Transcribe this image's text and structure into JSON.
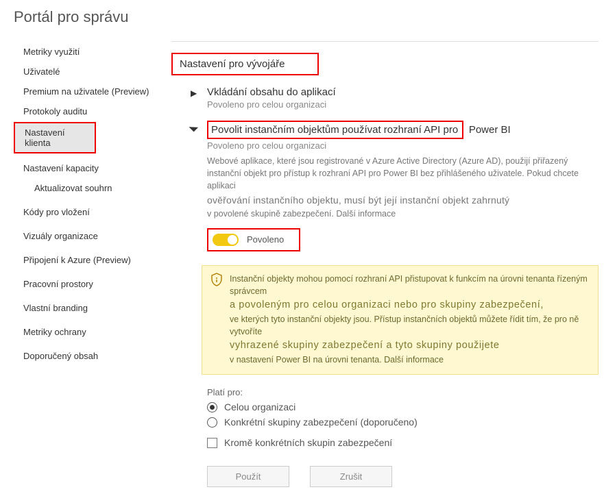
{
  "page_title": "Portál pro správu",
  "sidebar": {
    "items": [
      {
        "label": "Metriky využití"
      },
      {
        "label": "Uživatelé"
      },
      {
        "label": "Premium na uživatele (Preview)"
      },
      {
        "label": "Protokoly auditu"
      },
      {
        "label": "Nastavení klienta",
        "selected": true,
        "highlight": true
      },
      {
        "label": "Nastavení kapacity"
      },
      {
        "label": "Aktualizovat souhrn",
        "sub": true
      },
      {
        "label": "Kódy pro vložení"
      },
      {
        "label": "Vizuály organizace"
      },
      {
        "label": "Připojení k Azure (Preview)"
      },
      {
        "label": "Pracovní prostory"
      },
      {
        "label": "Vlastní branding"
      },
      {
        "label": "Metriky ochrany"
      },
      {
        "label": "Doporučený obsah"
      }
    ]
  },
  "section_heading": "Nastavení pro vývojáře",
  "setting_embed": {
    "title": "Vkládání obsahu do aplikací",
    "status": "Povoleno pro celou organizaci"
  },
  "setting_sp": {
    "title": "Povolit instančním objektům používat rozhraní API pro",
    "title_suffix": "Power BI",
    "status": "Povoleno pro celou organizaci",
    "desc1": "Webové aplikace, které jsou registrované v Azure Active Directory (Azure AD), použijí přiřazený instanční objekt pro přístup k rozhraní API pro Power BI bez přihlášeného uživatele. Pokud chcete aplikaci ",
    "desc_em": "ověřování instančního objektu, musí být její instanční objekt zahrnutý",
    "desc2": "v povolené skupině zabezpečení. Další informace",
    "toggle_label": "Povoleno"
  },
  "warning": {
    "line1": "Instanční objekty mohou pomocí rozhraní API přistupovat k funkcím na úrovni tenanta řízeným správcem",
    "line_big1": "a povoleným pro celou organizaci nebo pro skupiny zabezpečení,",
    "line2": "ve kterých tyto instanční objekty jsou. Přístup instančních objektů můžete řídit tím, že pro ně vytvoříte",
    "line_big2": "vyhrazené skupiny zabezpečení a tyto skupiny použijete",
    "line3": "v nastavení Power BI na úrovni tenanta. Další informace"
  },
  "applies": {
    "label": "Platí pro:",
    "opt_org": "Celou organizaci",
    "opt_groups": "Konkrétní skupiny zabezpečení (doporučeno)",
    "opt_except": "Kromě konkrétních skupin zabezpečení"
  },
  "buttons": {
    "apply": "Použít",
    "cancel": "Zrušit"
  }
}
